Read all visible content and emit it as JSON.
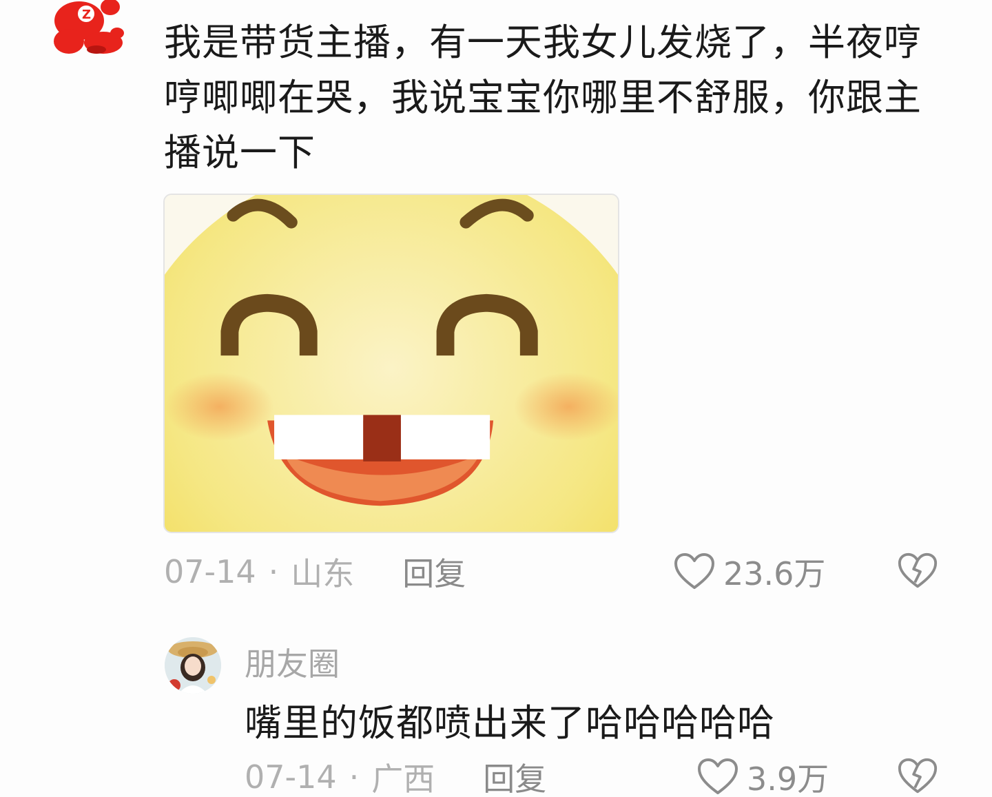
{
  "main_comment": {
    "avatar_icon": "red-cartoon-mascot-icon",
    "text": "我是带货主播，有一天我女儿发烧了，半夜哼哼唧唧在哭，我说宝宝你哪里不舒服，你跟主播说一下",
    "image": "yellow-grinning-emoji-meme",
    "date": "07-14",
    "location": "山东",
    "separator": "·",
    "reply_label": "回复",
    "like_count": "23.6万",
    "like_icon": "heart-outline-icon",
    "dislike_icon": "broken-heart-icon"
  },
  "reply_comment": {
    "avatar_icon": "user-photo-avatar",
    "username": "朋友圈",
    "text": "嘴里的饭都喷出来了哈哈哈哈哈",
    "date": "07-14",
    "location": "广西",
    "separator": "·",
    "reply_label": "回复",
    "like_count": "3.9万",
    "like_icon": "heart-outline-icon",
    "dislike_icon": "broken-heart-icon"
  },
  "colors": {
    "meta_gray": "#b0b0b0",
    "count_gray": "#8c8c8c",
    "text_dark": "#1a1a1a",
    "avatar_red": "#e8231c"
  }
}
